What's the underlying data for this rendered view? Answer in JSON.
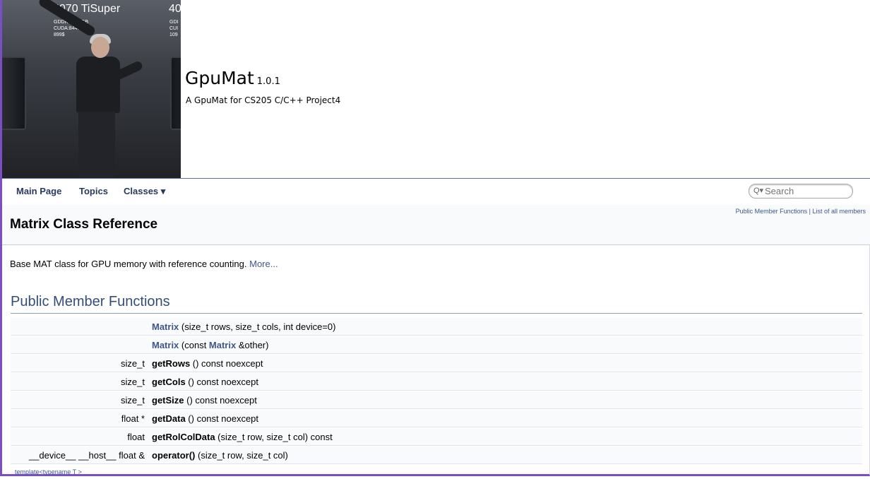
{
  "header": {
    "logo_text": {
      "left_title": "4070 TiSuper",
      "left_specs": [
        "GDDR6X 16GB",
        "CUDA:8448",
        "899$"
      ],
      "right_title": "40",
      "right_specs": [
        "GDI",
        "CUI",
        "109"
      ]
    },
    "project_name": "GpuMat",
    "project_number": "1.0.1",
    "project_brief": "A GpuMat for CS205 C/C++ Project4"
  },
  "nav": {
    "items": [
      "Main Page",
      "Topics",
      "Classes ▾"
    ],
    "search_placeholder": "Search"
  },
  "page": {
    "summary_links": [
      "Public Member Functions",
      "List of all members"
    ],
    "summary_sep": " | ",
    "title": "Matrix Class Reference",
    "brief": "Base MAT class for GPU memory with reference counting.",
    "more": "More..."
  },
  "section": {
    "title": "Public Member Functions",
    "members": [
      {
        "type": "",
        "name": "Matrix",
        "args": " (size_t rows, size_t cols, int device=0)"
      },
      {
        "type": "",
        "name": "Matrix",
        "args_pre": " (const ",
        "args_link": "Matrix",
        "args_post": " &other)"
      },
      {
        "type": "size_t",
        "name": "getRows",
        "args": " () const noexcept"
      },
      {
        "type": "size_t",
        "name": "getCols",
        "args": " () const noexcept"
      },
      {
        "type": "size_t",
        "name": "getSize",
        "args": " () const noexcept"
      },
      {
        "type": "float *",
        "name": "getData",
        "args": " () const noexcept"
      },
      {
        "type": "float",
        "name": "getRolColData",
        "args": " (size_t row, size_t col) const"
      },
      {
        "type": "__device__ __host__ float &",
        "name": "operator()",
        "args": " (size_t row, size_t col)"
      }
    ],
    "template_line": "template<typename T >"
  },
  "colors": {
    "accent_border": "#7b4fc4",
    "link": "#3d578c",
    "nav_text": "#283a5d",
    "section_title": "#354c7b"
  }
}
